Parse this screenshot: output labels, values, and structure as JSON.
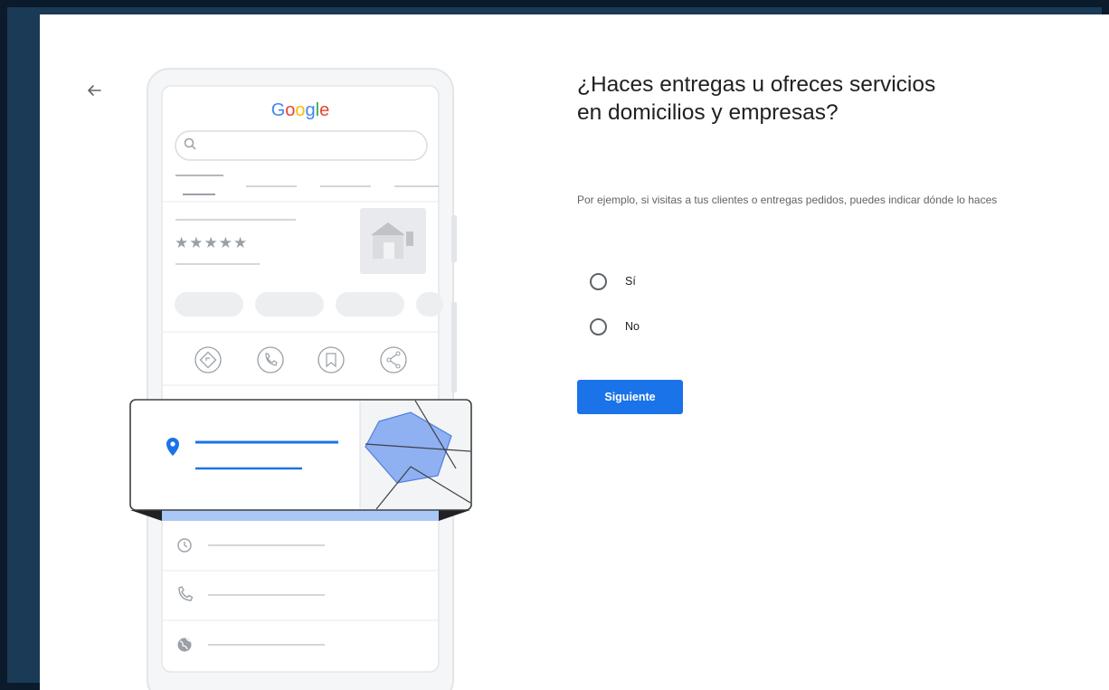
{
  "header": {
    "back_icon": "arrow-left-icon"
  },
  "illustration": {
    "logo_text": "Google",
    "logo_letters": [
      {
        "char": "G",
        "color": "#4285F4"
      },
      {
        "char": "o",
        "color": "#EA4335"
      },
      {
        "char": "o",
        "color": "#FBBC05"
      },
      {
        "char": "g",
        "color": "#4285F4"
      },
      {
        "char": "l",
        "color": "#34A853"
      },
      {
        "char": "e",
        "color": "#EA4335"
      }
    ],
    "rating_stars": "★★★★★",
    "accent_color": "#4285F4"
  },
  "question": {
    "title": "¿Haces entregas u ofreces servicios en domicilios y empresas?",
    "description": "Por ejemplo, si visitas a tus clientes o entregas pedidos, puedes indicar dónde lo haces"
  },
  "options": [
    {
      "label": "Sí",
      "checked": false
    },
    {
      "label": "No",
      "checked": false
    }
  ],
  "actions": {
    "next_label": "Siguiente"
  },
  "colors": {
    "primary": "#1a73e8",
    "text": "#202124",
    "muted": "#5f6368"
  }
}
